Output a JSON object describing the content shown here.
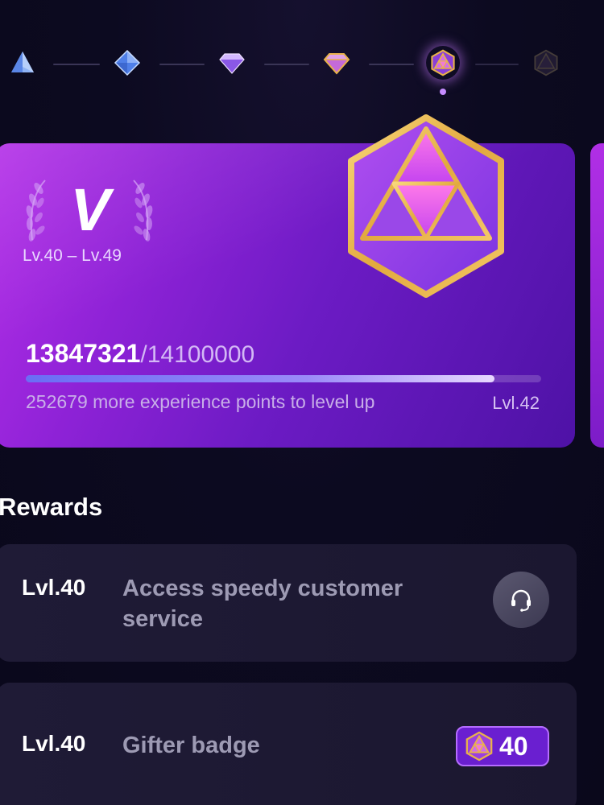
{
  "tiers": [
    {
      "name": "tier-i",
      "icon": "pyramid-icon",
      "color": "#7aa6f2",
      "state": "done"
    },
    {
      "name": "tier-ii",
      "icon": "octahedron-icon",
      "color": "#5c8ef0",
      "state": "done"
    },
    {
      "name": "tier-iii",
      "icon": "diamond-icon",
      "color": "#b58cf5",
      "state": "done"
    },
    {
      "name": "tier-iv",
      "icon": "gold-diamond-icon",
      "color": "#d9a548",
      "state": "done"
    },
    {
      "name": "tier-v",
      "icon": "icosahedron-icon",
      "color": "#e6b34a",
      "state": "current"
    },
    {
      "name": "tier-vi",
      "icon": "icosahedron-locked-icon",
      "color": "#6b5b78",
      "state": "locked"
    }
  ],
  "card": {
    "tier_letter": "V",
    "level_range": "Lv.40 – Lv.49",
    "xp_current": "13847321",
    "xp_target": "/14100000",
    "progress_fraction": 0.91,
    "remaining_text": "252679 more experience points to level up",
    "current_level": "Lvl.42"
  },
  "rewards": {
    "title": "Rewards",
    "items": [
      {
        "level": "Lvl.40",
        "description": "Access speedy customer service",
        "icon": "headset-icon"
      },
      {
        "level": "Lvl.40",
        "description": "Gifter badge",
        "icon": "icosahedron-badge-icon",
        "badge_value": "40"
      }
    ]
  },
  "colors": {
    "background": "#0d0a22",
    "card_start": "#b42ee8",
    "card_end": "#4e12a6",
    "gold": "#e6b34a",
    "accent": "#b56cff"
  }
}
